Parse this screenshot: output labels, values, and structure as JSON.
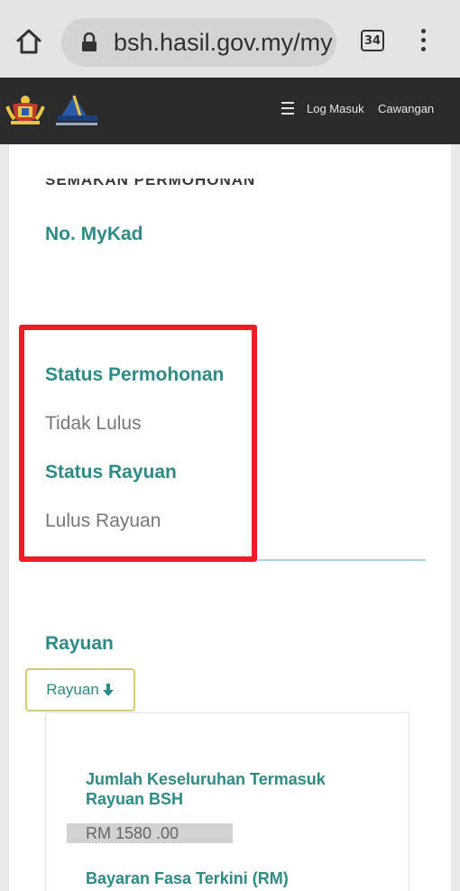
{
  "browser": {
    "url": "bsh.hasil.gov.my/my",
    "tab_count": "34"
  },
  "header": {
    "nav": [
      {
        "label": "Log Masuk"
      },
      {
        "label": "Cawangan"
      }
    ],
    "colors": {
      "background": "#2b2b2b",
      "text": "#e8e8e8"
    }
  },
  "form": {
    "cut_off_label": "SEMAKAN PERMOHONAN",
    "mykad_label": "No. MyKad",
    "status_permohonan_label": "Status Permohonan",
    "status_permohonan_value": "Tidak Lulus",
    "status_rayuan_label": "Status Rayuan",
    "status_rayuan_value": "Lulus Rayuan"
  },
  "rayuan": {
    "heading": "Rayuan",
    "button_label": "Rayuan",
    "summary": {
      "total_label": "Jumlah Keseluruhan Termasuk Rayuan BSH",
      "total_amount": "RM 1580 .00",
      "latest_label": "Bayaran Fasa Terkini (RM)"
    }
  },
  "colors": {
    "accent": "#2e8a84",
    "value_text": "#777777",
    "highlight": "#ee1c24",
    "button_border": "#d7c874"
  }
}
